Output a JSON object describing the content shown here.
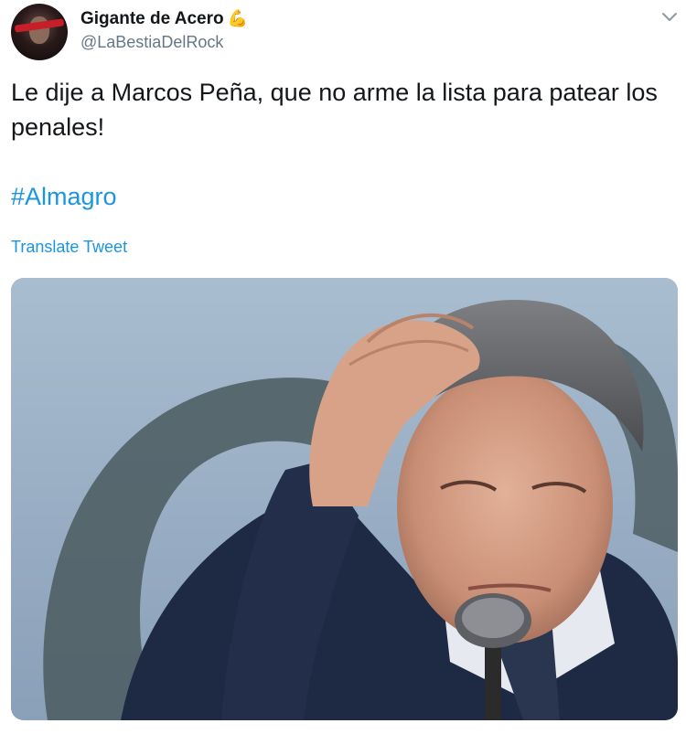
{
  "tweet": {
    "author": {
      "display_name": "Gigante de Acero",
      "name_emoji": "💪",
      "handle": "@LaBestiaDelRock",
      "avatar_icon": "avatar-image"
    },
    "menu_icon": "chevron-down-icon",
    "text": "Le dije a Marcos Peña, que no arme la lista para patear los penales!",
    "hashtag": "#Almagro",
    "translate_label": "Translate Tweet",
    "media": {
      "subject": "photo of a man with his hand on his forehead in front of a microphone"
    }
  },
  "colors": {
    "link": "#1b95e0",
    "text": "#14171a",
    "secondary": "#657786"
  }
}
